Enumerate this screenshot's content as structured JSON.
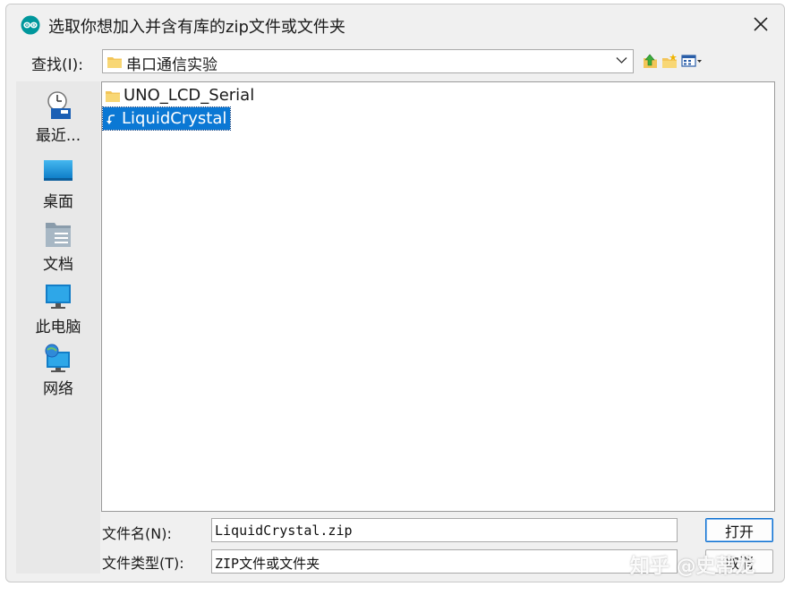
{
  "dialog": {
    "title": "选取你想加入并含有库的zip文件或文件夹",
    "app_icon": "arduino-logo-icon",
    "close_icon": "close-icon"
  },
  "lookin": {
    "label": "查找(I):",
    "path": "串口通信实验"
  },
  "toolbar": {
    "icons": [
      "up-folder-icon",
      "new-folder-icon",
      "view-menu-icon"
    ]
  },
  "places": [
    {
      "label": "最近...",
      "icon": "recent-icon"
    },
    {
      "label": "桌面",
      "icon": "desktop-icon"
    },
    {
      "label": "文档",
      "icon": "documents-icon"
    },
    {
      "label": "此电脑",
      "icon": "computer-icon"
    },
    {
      "label": "网络",
      "icon": "network-icon"
    }
  ],
  "files": [
    {
      "name": "UNO_LCD_Serial",
      "icon": "folder-icon",
      "selected": false
    },
    {
      "name": "LiquidCrystal",
      "icon": "shortcut-arrow-icon",
      "selected": true
    }
  ],
  "filename": {
    "label": "文件名(N):",
    "value": "LiquidCrystal.zip"
  },
  "filetype": {
    "label": "文件类型(T):",
    "value": "ZIP文件或文件夹"
  },
  "buttons": {
    "open": "打开",
    "cancel": "取消"
  },
  "watermark": "知乎 @史蒂龙",
  "colors": {
    "selection": "#0b78d4",
    "dialog_bg": "#f0f0f0",
    "places_bg": "#e8e8e8"
  }
}
